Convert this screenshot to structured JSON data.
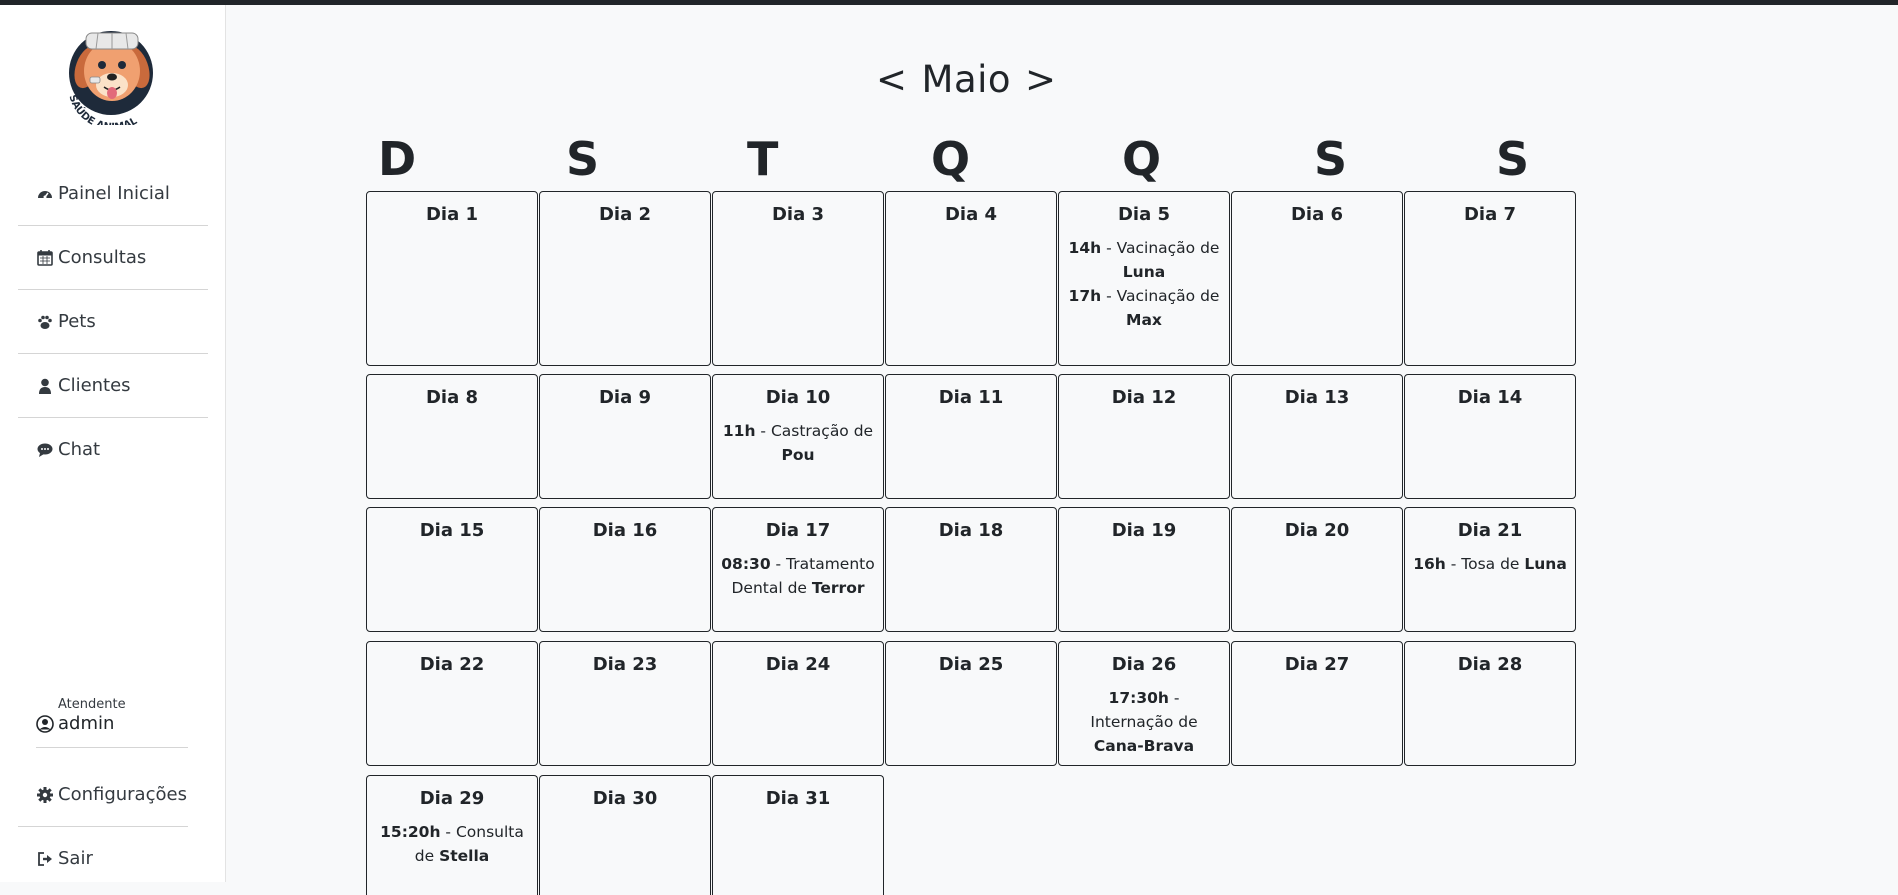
{
  "app": {
    "logo_text": "SAÚDE ANIMAL"
  },
  "sidebar": {
    "items": [
      {
        "label": "Painel Inicial",
        "icon": "dashboard-icon"
      },
      {
        "label": "Consultas",
        "icon": "calendar-icon"
      },
      {
        "label": "Pets",
        "icon": "paw-icon"
      },
      {
        "label": "Clientes",
        "icon": "user-icon"
      },
      {
        "label": "Chat",
        "icon": "chat-icon"
      }
    ],
    "user": {
      "role": "Atendente",
      "name": "admin"
    },
    "bottom_items": [
      {
        "label": "Configurações",
        "icon": "gear-icon"
      },
      {
        "label": "Sair",
        "icon": "sign-out-icon"
      }
    ]
  },
  "calendar": {
    "month": "Maio",
    "prev": "<",
    "next": ">",
    "weekdays": [
      "D",
      "S",
      "T",
      "Q",
      "Q",
      "S",
      "S"
    ],
    "days": [
      {
        "label": "Dia 1",
        "events": []
      },
      {
        "label": "Dia 2",
        "events": []
      },
      {
        "label": "Dia 3",
        "events": []
      },
      {
        "label": "Dia 4",
        "events": []
      },
      {
        "label": "Dia 5",
        "events": [
          {
            "time": "14h",
            "text": " - Vacinação de ",
            "pet": "Luna"
          },
          {
            "time": "17h",
            "text": " - Vacinação de ",
            "pet": "Max"
          }
        ]
      },
      {
        "label": "Dia 6",
        "events": []
      },
      {
        "label": "Dia 7",
        "events": []
      },
      {
        "label": "Dia 8",
        "events": []
      },
      {
        "label": "Dia 9",
        "events": []
      },
      {
        "label": "Dia 10",
        "events": [
          {
            "time": "11h",
            "text": " - Castração de ",
            "pet": "Pou"
          }
        ]
      },
      {
        "label": "Dia 11",
        "events": []
      },
      {
        "label": "Dia 12",
        "events": []
      },
      {
        "label": "Dia 13",
        "events": []
      },
      {
        "label": "Dia 14",
        "events": []
      },
      {
        "label": "Dia 15",
        "events": []
      },
      {
        "label": "Dia 16",
        "events": []
      },
      {
        "label": "Dia 17",
        "events": [
          {
            "time": "08:30",
            "text": " - Tratamento Dental de ",
            "pet": "Terror"
          }
        ]
      },
      {
        "label": "Dia 18",
        "events": []
      },
      {
        "label": "Dia 19",
        "events": []
      },
      {
        "label": "Dia 20",
        "events": []
      },
      {
        "label": "Dia 21",
        "events": [
          {
            "time": "16h",
            "text": " - Tosa de ",
            "pet": "Luna"
          }
        ]
      },
      {
        "label": "Dia 22",
        "events": []
      },
      {
        "label": "Dia 23",
        "events": []
      },
      {
        "label": "Dia 24",
        "events": []
      },
      {
        "label": "Dia 25",
        "events": []
      },
      {
        "label": "Dia 26",
        "events": [
          {
            "time": "17:30h",
            "text": " - Internação de ",
            "pet": "Cana-Brava"
          }
        ]
      },
      {
        "label": "Dia 27",
        "events": []
      },
      {
        "label": "Dia 28",
        "events": []
      },
      {
        "label": "Dia 29",
        "events": [
          {
            "time": "15:20h",
            "text": " - Consulta de ",
            "pet": "Stella"
          }
        ]
      },
      {
        "label": "Dia 30",
        "events": []
      },
      {
        "label": "Dia 31",
        "events": []
      }
    ]
  },
  "colors": {
    "sidebar_bg": "#ffffff",
    "page_bg": "#f8f9fa",
    "text": "#212529",
    "border": "#212529",
    "topbar": "#212529"
  }
}
